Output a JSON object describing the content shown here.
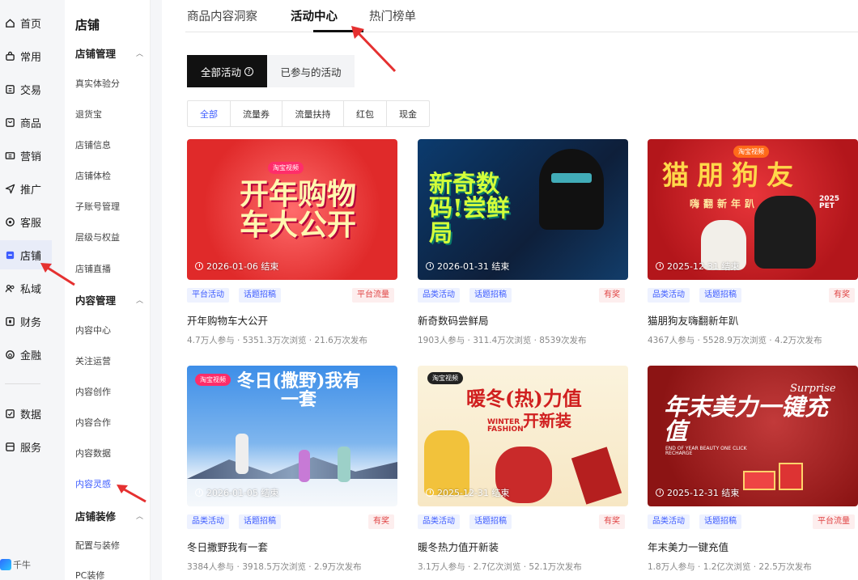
{
  "rail": {
    "items": [
      {
        "label": "首页",
        "icon": "home-icon"
      },
      {
        "label": "常用",
        "icon": "bag-icon"
      },
      {
        "label": "交易",
        "icon": "ledger-icon"
      },
      {
        "label": "商品",
        "icon": "box-icon"
      },
      {
        "label": "营销",
        "icon": "ticket-icon"
      },
      {
        "label": "推广",
        "icon": "send-icon"
      },
      {
        "label": "客服",
        "icon": "headset-icon"
      },
      {
        "label": "店铺",
        "icon": "store-icon"
      },
      {
        "label": "私域",
        "icon": "people-icon"
      },
      {
        "label": "财务",
        "icon": "wallet-icon"
      },
      {
        "label": "金融",
        "icon": "coin-icon"
      },
      {
        "label": "数据",
        "icon": "chart-icon"
      },
      {
        "label": "服务",
        "icon": "service-icon"
      }
    ],
    "active": "店铺",
    "footer_label": "千牛"
  },
  "subnav": {
    "title": "店铺",
    "group_shop": "店铺管理",
    "items_shop": [
      "真实体验分",
      "退货宝",
      "店铺信息",
      "店铺体检",
      "子账号管理",
      "层级与权益",
      "店铺直播"
    ],
    "group_content": "内容管理",
    "items_content": [
      "内容中心",
      "关注运营",
      "内容创作",
      "内容合作",
      "内容数据",
      "内容灵感"
    ],
    "group_decor": "店铺装修",
    "items_decor": [
      "配置与装修",
      "PC装修"
    ],
    "active": "内容灵感"
  },
  "tabs": [
    "商品内容洞察",
    "活动中心",
    "热门榜单"
  ],
  "active_tab": "活动中心",
  "segment": {
    "all": "全部活动",
    "joined": "已参与的活动"
  },
  "filters": [
    "全部",
    "流量券",
    "流量扶持",
    "红包",
    "现金"
  ],
  "active_filter": "全部",
  "accent_color": "#3d5cff",
  "cards": [
    {
      "banner_text": "开年购物车大公开",
      "badge": "淘宝视频",
      "date": "2026-01-06 结束",
      "tags": [
        "平台活动",
        "话题招稿"
      ],
      "reward": "平台流量",
      "title": "开年购物车大公开",
      "stats": "4.7万人参与 · 5351.3万次浏览 · 21.6万次发布"
    },
    {
      "banner_text": "新奇数码!尝鲜局",
      "date": "2026-01-31 结束",
      "tags": [
        "品类活动",
        "话题招稿"
      ],
      "reward": "有奖",
      "title": "新奇数码尝鲜局",
      "stats": "1903人参与 · 311.4万次浏览 · 8539次发布"
    },
    {
      "banner_text": "猫朋狗友",
      "banner_sub": "嗨翻新年趴",
      "banner_year": "2025 PET",
      "badge": "淘宝视频",
      "date": "2025-12-31 结束",
      "tags": [
        "品类活动",
        "话题招稿"
      ],
      "reward": "有奖",
      "title": "猫朋狗友嗨翻新年趴",
      "stats": "4367人参与 · 5528.9万次浏览 · 4.2万次发布"
    },
    {
      "banner_text": "冬日(撒野)我有一套",
      "badge": "淘宝视频",
      "date": "2026-01-05 结束",
      "tags": [
        "品类活动",
        "话题招稿"
      ],
      "reward": "有奖",
      "title": "冬日撒野我有一套",
      "stats": "3384人参与 · 3918.5万次浏览 · 2.9万次发布"
    },
    {
      "banner_text": "暖冬(热)力值",
      "banner_sub": "开新装",
      "banner_en": "WINTER FASHION",
      "badge": "淘宝视频",
      "date": "2025-12-31 结束",
      "tags": [
        "品类活动",
        "话题招稿"
      ],
      "reward": "有奖",
      "title": "暖冬热力值开新装",
      "stats": "3.1万人参与 · 2.7亿次浏览 · 52.1万次发布"
    },
    {
      "banner_text": "年末美力一键充值",
      "banner_en": "END OF YEAR BEAUTY ONE CLICK RECHARGE",
      "banner_script": "Surprise",
      "date": "2025-12-31 结束",
      "tags": [
        "品类活动",
        "话题招稿"
      ],
      "reward": "平台流量",
      "title": "年末美力一键充值",
      "stats": "1.8万人参与 · 1.2亿次浏览 · 22.5万次发布"
    }
  ]
}
